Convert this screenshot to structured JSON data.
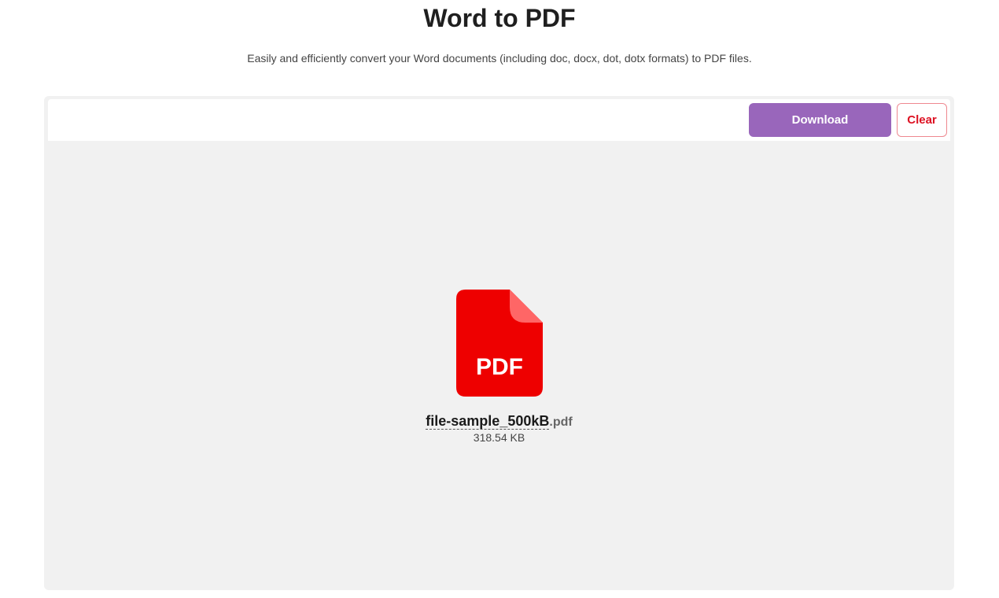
{
  "header": {
    "title": "Word to PDF",
    "subtitle": "Easily and efficiently convert your Word documents (including doc, docx, dot, dotx formats) to PDF files."
  },
  "toolbar": {
    "download_label": "Download",
    "clear_label": "Clear"
  },
  "file": {
    "icon": "pdf-file-icon",
    "icon_label": "PDF",
    "name": "file-sample_500kB",
    "extension": ".pdf",
    "size": "318.54 KB"
  },
  "colors": {
    "accent": "#9966bb",
    "danger": "#dd1122",
    "pdf_red": "#ee0000",
    "pdf_fold": "#ff6666",
    "panel_bg": "#f1f1f1"
  }
}
